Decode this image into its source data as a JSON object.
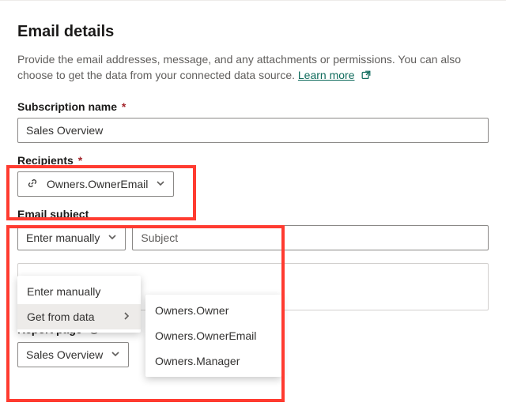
{
  "heading": "Email details",
  "description_pre": "Provide the email addresses, message, and any attachments or permissions. You can also choose to get the data from your connected data source. ",
  "learn_more": "Learn more",
  "fields": {
    "subscription_name": {
      "label": "Subscription name",
      "value": "Sales Overview"
    },
    "recipients": {
      "label": "Recipients",
      "chip": "Owners.OwnerEmail"
    },
    "email_subject": {
      "label": "Email subject",
      "mode_label": "Enter manually",
      "placeholder": "Subject",
      "value": ""
    },
    "report_page": {
      "label": "Report page",
      "value": "Sales Overview"
    }
  },
  "dropdown": {
    "items": [
      {
        "label": "Enter manually",
        "has_sub": false
      },
      {
        "label": "Get from data",
        "has_sub": true
      }
    ],
    "submenu": [
      "Owners.Owner",
      "Owners.OwnerEmail",
      "Owners.Manager"
    ]
  },
  "required_marker": "*"
}
